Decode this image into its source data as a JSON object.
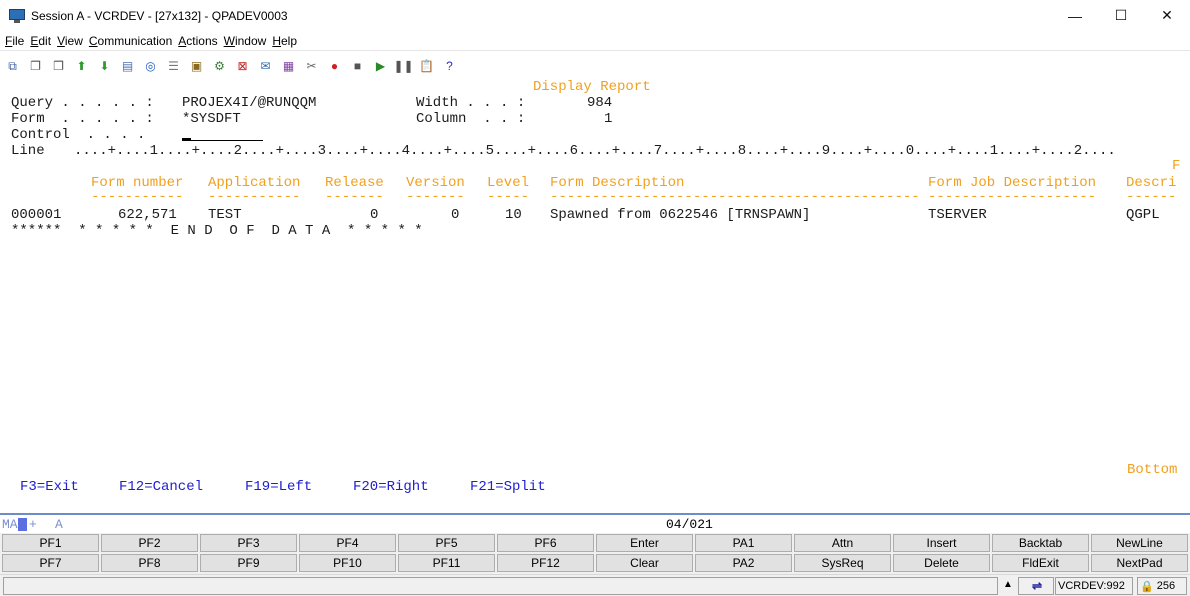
{
  "window": {
    "title": "Session A - VCRDEV - [27x132] - QPADEV0003",
    "minimize": "—",
    "maximize": "☐",
    "close": "✕"
  },
  "menu": {
    "items": [
      {
        "accel": "F",
        "rest": "ile"
      },
      {
        "accel": "E",
        "rest": "dit"
      },
      {
        "accel": "V",
        "rest": "iew"
      },
      {
        "accel": "C",
        "rest": "ommunication"
      },
      {
        "accel": "A",
        "rest": "ctions"
      },
      {
        "accel": "W",
        "rest": "indow"
      },
      {
        "accel": "H",
        "rest": "elp"
      }
    ]
  },
  "toolbar": {
    "icons": [
      "copy-icon",
      "paste-icon",
      "paste-append-icon",
      "send-file-icon",
      "receive-file-icon",
      "macro-icon",
      "browser-icon",
      "notes-icon",
      "package-icon",
      "settings-icon",
      "disconnect-icon",
      "email-icon",
      "grid-icon",
      "tools-icon",
      "record-icon",
      "stop-icon",
      "play-icon",
      "pause-icon",
      "clipboard-icon",
      "help-icon"
    ]
  },
  "screen": {
    "heading": "Display Report",
    "query_label": "Query . . . . . :",
    "query_value": "PROJEX4I/@RUNQQM",
    "form_label": "Form  . . . . . :",
    "form_value": "*SYSDFT",
    "control_label": "Control  . . . .",
    "width_label": "Width . . . :",
    "width_value": "984",
    "column_label": "Column  . . :",
    "column_value": "1",
    "line_label": "Line",
    "ruler": "....+....1....+....2....+....3....+....4....+....5....+....6....+....7....+....8....+....9....+....0....+....1....+....2....",
    "overflow_char": "F",
    "columns": [
      {
        "header": "Form number",
        "dashes": "-----------"
      },
      {
        "header": "Application",
        "dashes": "-----------"
      },
      {
        "header": "Release",
        "dashes": "-------"
      },
      {
        "header": "Version",
        "dashes": "-------"
      },
      {
        "header": "Level",
        "dashes": "-----"
      },
      {
        "header": "Form Description",
        "dashes": "--------------------------------------------"
      },
      {
        "header": "Form Job Description",
        "dashes": "--------------------"
      },
      {
        "header": "Descri",
        "dashes": "------"
      }
    ],
    "row": {
      "line": "000001",
      "form_number": "622,571",
      "application": "TEST",
      "release": "0",
      "version": "0",
      "level": "10",
      "description": "Spawned from 0622546 [TRNSPAWN]",
      "job_description": "TSERVER",
      "descri": "QGPL"
    },
    "end_of_data": "******  * * * * *  E N D  O F  D A T A  * * * * *",
    "bottom": "Bottom",
    "function_keys": [
      "F3=Exit",
      "F12=Cancel",
      "F19=Left",
      "F20=Right",
      "F21=Split"
    ]
  },
  "oia": {
    "ma": "MA",
    "plus": "+",
    "a": "A",
    "cursor_pos": "04/021"
  },
  "keypad": {
    "row1": [
      "PF1",
      "PF2",
      "PF3",
      "PF4",
      "PF5",
      "PF6",
      "Enter",
      "PA1",
      "Attn",
      "Insert",
      "Backtab",
      "NewLine"
    ],
    "row2": [
      "PF7",
      "PF8",
      "PF9",
      "PF10",
      "PF11",
      "PF12",
      "Clear",
      "PA2",
      "SysReq",
      "Delete",
      "FldExit",
      "NextPad"
    ]
  },
  "statusbar": {
    "host": "VCRDEV:992",
    "code": "256"
  },
  "colors": {
    "field_text": "#1b1b1b",
    "column_headers": "#f0a020",
    "function_keys": "#2020d0",
    "oia_border": "#6c8ec8"
  }
}
